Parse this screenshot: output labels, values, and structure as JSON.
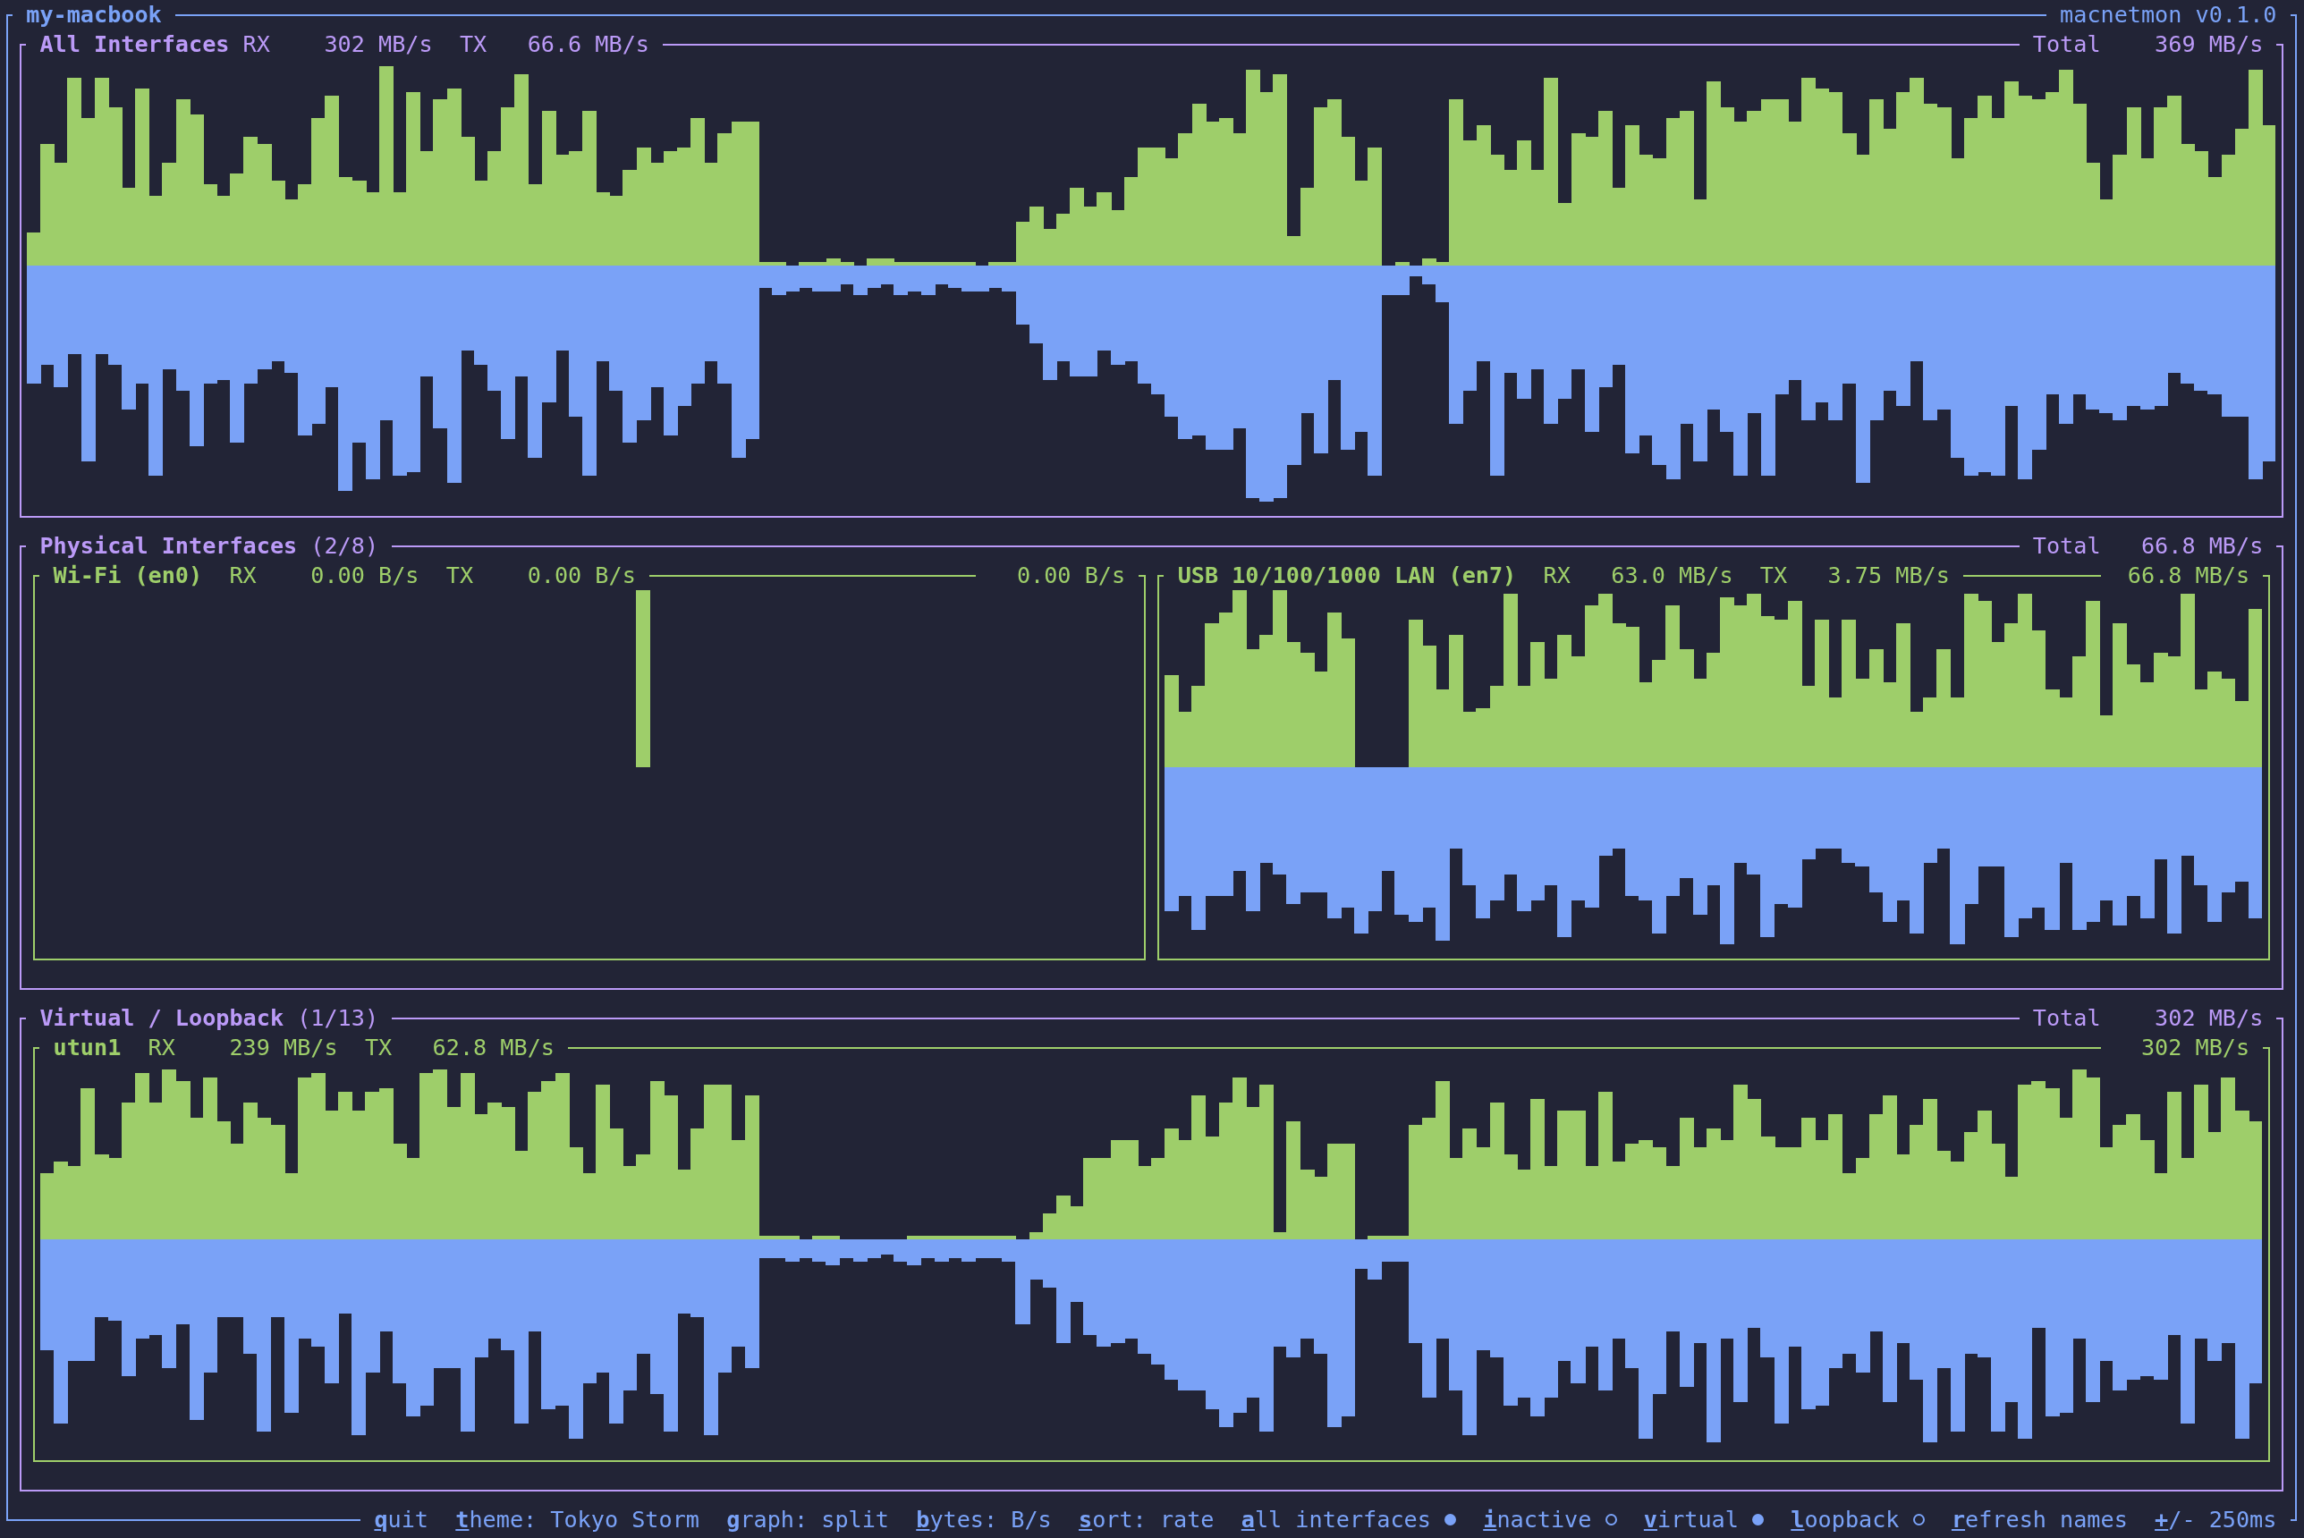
{
  "window": {
    "hostname": "my-macbook",
    "app_version": "macnetmon v0.1.0"
  },
  "summary": {
    "title": "All Interfaces",
    "rx_label": "RX",
    "rx": "302 MB/s",
    "tx_label": "TX",
    "tx": "66.6 MB/s",
    "total_label": "Total",
    "total": "369 MB/s"
  },
  "groups": [
    {
      "title": "Physical Interfaces",
      "count": "(2/8)",
      "total_label": "Total",
      "total": "66.8 MB/s",
      "interfaces": [
        {
          "name": "Wi-Fi (en0)",
          "rx_label": "RX",
          "rx": "0.00 B/s",
          "tx_label": "TX",
          "tx": "0.00 B/s",
          "total": "0.00 B/s"
        },
        {
          "name": "USB 10/100/1000 LAN (en7)",
          "rx_label": "RX",
          "rx": "63.0 MB/s",
          "tx_label": "TX",
          "tx": "3.75 MB/s",
          "total": "66.8 MB/s"
        }
      ]
    },
    {
      "title": "Virtual / Loopback",
      "count": "(1/13)",
      "total_label": "Total",
      "total": "302 MB/s",
      "interfaces": [
        {
          "name": "utun1",
          "rx_label": "RX",
          "rx": "239 MB/s",
          "tx_label": "TX",
          "tx": "62.8 MB/s",
          "total": "302 MB/s"
        }
      ]
    }
  ],
  "status_bar": {
    "shortcuts": [
      {
        "kind": "action",
        "label": "**q**uit"
      },
      {
        "kind": "action",
        "label": "**t**heme: Tokyo Storm"
      },
      {
        "kind": "action",
        "label": "**g**raph: split"
      },
      {
        "kind": "action",
        "label": "**b**ytes: B/s"
      },
      {
        "kind": "action",
        "label": "**s**ort: rate"
      },
      {
        "kind": "toggle",
        "label": "**a**ll interfaces",
        "on": true
      },
      {
        "kind": "toggle",
        "label": "**i**nactive",
        "on": false
      },
      {
        "kind": "toggle",
        "label": "**v**irtual",
        "on": true
      },
      {
        "kind": "toggle",
        "label": "**l**oopback",
        "on": false
      },
      {
        "kind": "action",
        "label": "**r**efresh names"
      },
      {
        "kind": "action",
        "label": "**+**/- 250ms"
      }
    ]
  }
}
